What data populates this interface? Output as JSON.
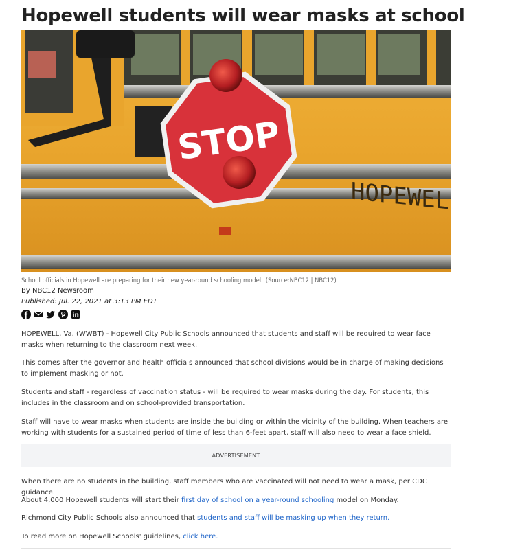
{
  "article": {
    "headline": "Hopewell students will wear masks at school",
    "image_caption": "School officials in Hopewell are preparing for their new year-round schooling model.",
    "image_credit": "(Source:NBC12 | NBC12)",
    "image_text": {
      "sign": "STOP",
      "bus_lettering": "HOPEWELL CITY PU"
    },
    "byline": "By NBC12 Newsroom",
    "published": "Published: Jul. 22, 2021 at 3:13 PM EDT",
    "share_icons": [
      "facebook-icon",
      "email-icon",
      "twitter-icon",
      "pinterest-icon",
      "linkedin-icon"
    ],
    "paragraphs": [
      "HOPEWELL, Va. (WWBT) - Hopewell City Public Schools announced that students and staff will be required to wear face masks when returning to the classroom next week.",
      "This comes after the governor and health officials announced that school divisions would be in charge of making decisions to implement masking or not.",
      "Students and staff - regardless of vaccination status - will be required to wear masks during the day. For students, this includes in the classroom and on school-provided transportation.",
      "Staff will have to wear masks when students are inside the building or within the vicinity of the building. When teachers are working with students for a sustained period of time of less than 6-feet apart, staff will also need to wear a face shield."
    ],
    "advertisement_label": "ADVERTISEMENT",
    "paragraphs_after_ad": {
      "p1": "When there are no students in the building, staff members who are vaccinated will not need to wear a mask, per CDC guidance.",
      "p2_before": "About 4,000 Hopewell students will start their ",
      "p2_link": "first day of school on a year-round schooling",
      "p2_after": " model on Monday.",
      "p3_before": "Richmond City Public Schools also announced that ",
      "p3_link": "students and staff will be masking up when they return.",
      "p4_before": "To read more on Hopewell Schools' guidelines, ",
      "p4_link": "click here."
    }
  },
  "colors": {
    "link": "#1e64c8",
    "bus_yellow": "#e8a628",
    "stop_red": "#d8323a"
  }
}
